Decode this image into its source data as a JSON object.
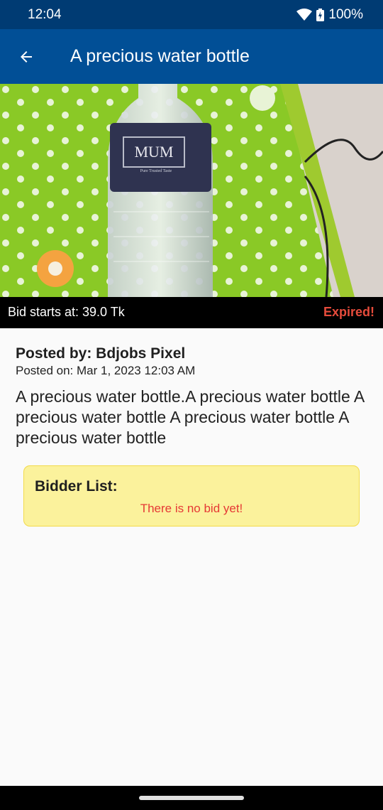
{
  "status_bar": {
    "time": "12:04",
    "battery": "100%"
  },
  "app_bar": {
    "title": "A precious water bottle",
    "back_icon": "arrow-left-icon"
  },
  "hero": {
    "label_brand": "MUM",
    "label_sub": "Pure Trusted Taste"
  },
  "price_bar": {
    "bid_text": "Bid starts at: 39.0 Tk",
    "status": "Expired!",
    "status_color": "#e74c3c"
  },
  "post": {
    "posted_by": "Posted by: Bdjobs Pixel",
    "posted_on": "Posted on: Mar 1, 2023 12:03 AM",
    "description": "A precious water bottle.A precious water bottle A precious water bottle A precious water bottle A precious water bottle"
  },
  "bidders": {
    "title": "Bidder List:",
    "empty_message": "There is no bid yet!"
  },
  "colors": {
    "primary": "#014f96",
    "status_bar": "#003b73",
    "card_bg": "#fbf29c",
    "error": "#e53935"
  }
}
